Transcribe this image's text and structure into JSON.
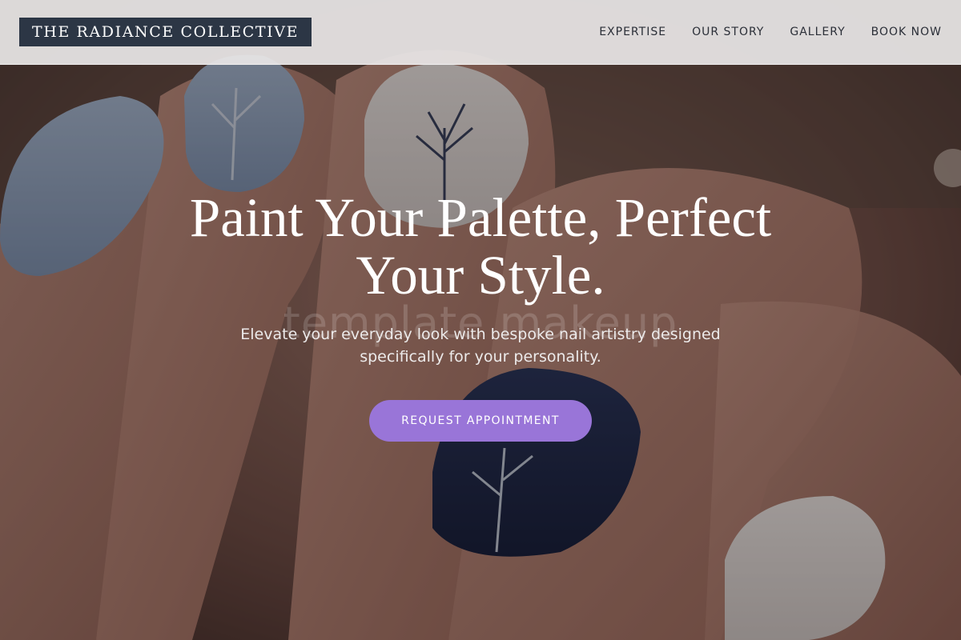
{
  "header": {
    "brand": "THE RADIANCE COLLECTIVE",
    "nav": [
      {
        "label": "EXPERTISE"
      },
      {
        "label": "OUR STORY"
      },
      {
        "label": "GALLERY"
      },
      {
        "label": "BOOK NOW"
      }
    ]
  },
  "hero": {
    "headline": "Paint Your Palette, Perfect Your Style.",
    "subheadline": "Elevate your everyday look with bespoke nail artistry designed specifically for your personality.",
    "cta_label": "REQUEST APPOINTMENT",
    "watermark": "template makeup",
    "image_icon": "manicured-hand-winter-nail-art"
  },
  "colors": {
    "brand_bg": "#2c3645",
    "cta_bg": "#9975d8",
    "header_bg": "#e8e6e6",
    "nav_text": "#2b2f38"
  }
}
